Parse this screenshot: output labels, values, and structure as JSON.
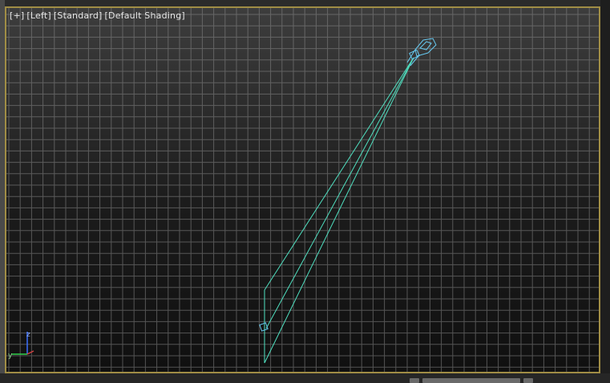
{
  "viewport": {
    "label_parts": [
      "[+]",
      "[Left]",
      "[Standard]",
      "[Default Shading]"
    ],
    "name": "Left"
  },
  "axis_gizmo": {
    "z_label": "z",
    "y_label": "y"
  },
  "colors": {
    "border_active": "#a08d45",
    "grid_line": "#8a8a8a",
    "camera_wire": "#66c9f0",
    "frustum_wire": "#4fe0c0",
    "axis_z": "#3b6fff",
    "axis_y": "#2fd04a"
  },
  "icons": {
    "camera": "camera-icon",
    "target": "camera-target-icon",
    "axis": "axis-tripod-icon"
  }
}
